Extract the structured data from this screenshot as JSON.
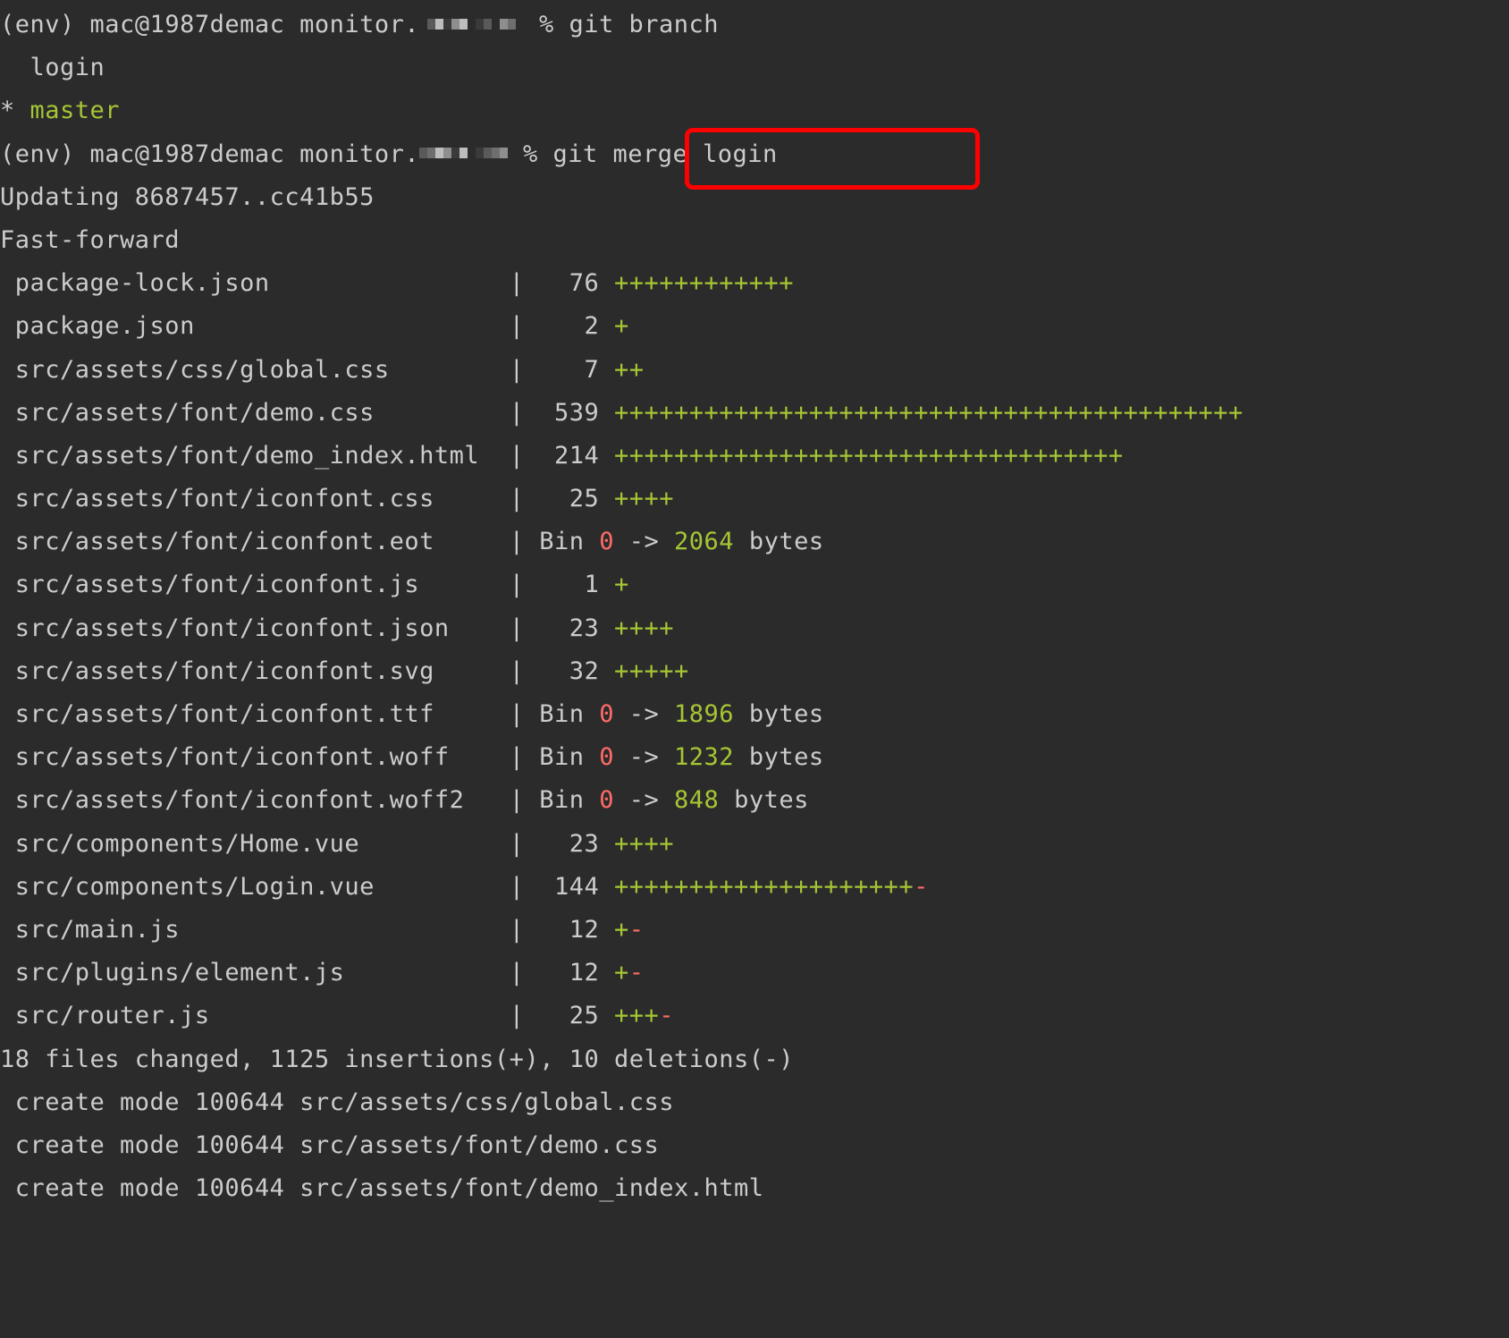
{
  "terminal": {
    "background_color": "#2b2b2b",
    "default_text_color": "#cccccc",
    "green_color": "#a5c634",
    "red_color": "#ff6b68",
    "highlight_color": "#ff0000",
    "prompt_env": "(env)",
    "prompt_user_host": "mac@1987demac",
    "prompt_path_prefix": "monitor.",
    "prompt_symbol": "%"
  },
  "annotation": {
    "highlight_label": "git merge login",
    "shape": "rectangle",
    "color": "#ff0000"
  },
  "commands": {
    "branch_command": "git branch",
    "merge_command": "git merge login"
  },
  "branches": {
    "current_marker": "*",
    "items": [
      {
        "name": "login",
        "current": false
      },
      {
        "name": "master",
        "current": true
      }
    ]
  },
  "merge_output": {
    "updating_line": "Updating 8687457..cc41b55",
    "strategy_line": "Fast-forward",
    "summary_line": "18 files changed, 1125 insertions(+), 10 deletions(-)",
    "files_changed": 18,
    "insertions": 1125,
    "deletions": 10,
    "files": [
      {
        "path": "package-lock.json",
        "count": "76",
        "bar": "++++++++++++",
        "binary": false
      },
      {
        "path": "package.json",
        "count": "2",
        "bar": "+",
        "binary": false
      },
      {
        "path": "src/assets/css/global.css",
        "count": "7",
        "bar": "++",
        "binary": false
      },
      {
        "path": "src/assets/font/demo.css",
        "count": "539",
        "bar": "++++++++++++++++++++++++++++++++++++++++++",
        "binary": false
      },
      {
        "path": "src/assets/font/demo_index.html",
        "count": "214",
        "bar": "++++++++++++++++++++++++++++++++++",
        "binary": false
      },
      {
        "path": "src/assets/font/iconfont.css",
        "count": "25",
        "bar": "++++",
        "binary": false
      },
      {
        "path": "src/assets/font/iconfont.eot",
        "count": "Bin",
        "binary": true,
        "from_bytes": "0",
        "arrow": "->",
        "to_bytes": "2064",
        "bytes_label": "bytes"
      },
      {
        "path": "src/assets/font/iconfont.js",
        "count": "1",
        "bar": "+",
        "binary": false
      },
      {
        "path": "src/assets/font/iconfont.json",
        "count": "23",
        "bar": "++++",
        "binary": false
      },
      {
        "path": "src/assets/font/iconfont.svg",
        "count": "32",
        "bar": "+++++",
        "binary": false
      },
      {
        "path": "src/assets/font/iconfont.ttf",
        "count": "Bin",
        "binary": true,
        "from_bytes": "0",
        "arrow": "->",
        "to_bytes": "1896",
        "bytes_label": "bytes"
      },
      {
        "path": "src/assets/font/iconfont.woff",
        "count": "Bin",
        "binary": true,
        "from_bytes": "0",
        "arrow": "->",
        "to_bytes": "1232",
        "bytes_label": "bytes"
      },
      {
        "path": "src/assets/font/iconfont.woff2",
        "count": "Bin",
        "binary": true,
        "from_bytes": "0",
        "arrow": "->",
        "to_bytes": "848",
        "bytes_label": "bytes"
      },
      {
        "path": "src/components/Home.vue",
        "count": "23",
        "bar": "++++",
        "binary": false
      },
      {
        "path": "src/components/Login.vue",
        "count": "144",
        "bar": "++++++++++++++++++++",
        "minus": "-",
        "binary": false
      },
      {
        "path": "src/main.js",
        "count": "12",
        "bar": "+",
        "minus": "-",
        "binary": false
      },
      {
        "path": "src/plugins/element.js",
        "count": "12",
        "bar": "+",
        "minus": "-",
        "binary": false
      },
      {
        "path": "src/router.js",
        "count": "25",
        "bar": "+++",
        "minus": "-",
        "binary": false
      }
    ],
    "create_modes": [
      {
        "text": "create mode 100644 src/assets/css/global.css"
      },
      {
        "text": "create mode 100644 src/assets/font/demo.css"
      },
      {
        "text": "create mode 100644 src/assets/font/demo_index.html"
      }
    ]
  }
}
